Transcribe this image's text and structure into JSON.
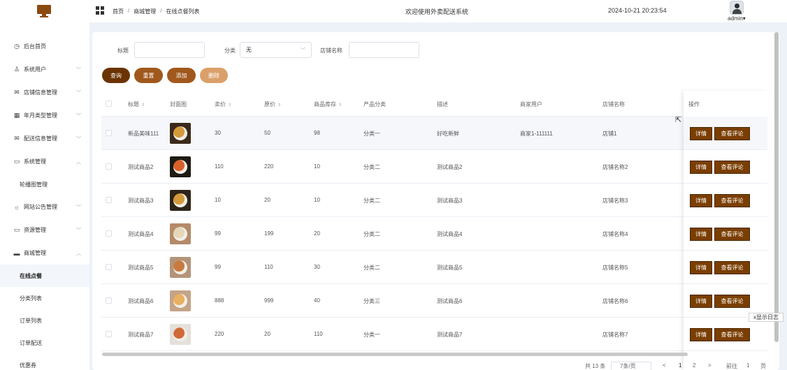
{
  "sidebar": {
    "items": [
      {
        "label": "后台首页",
        "icon": "clock-icon",
        "expand": ""
      },
      {
        "label": "系统用户",
        "icon": "user-icon",
        "expand": "chevron-down"
      },
      {
        "label": "店铺信息管理",
        "icon": "mail-icon",
        "expand": "chevron-down"
      },
      {
        "label": "年月类型管理",
        "icon": "calendar-icon",
        "expand": "chevron-down"
      },
      {
        "label": "配送信息管理",
        "icon": "mail-icon",
        "expand": "chevron-down"
      },
      {
        "label": "系统管理",
        "icon": "folder-icon",
        "expand": "chevron-up"
      }
    ],
    "system_sub": [
      {
        "label": "轮播图管理"
      }
    ],
    "items2": [
      {
        "label": "网站公告管理",
        "icon": "sun-icon",
        "expand": "chevron-down"
      },
      {
        "label": "资源管理",
        "icon": "monitor-icon",
        "expand": "chevron-down"
      },
      {
        "label": "商城管理",
        "icon": "shop-icon",
        "expand": "chevron-up"
      }
    ],
    "mall_sub": [
      {
        "label": "在线点餐",
        "active": true
      },
      {
        "label": "分类列表",
        "active": false
      },
      {
        "label": "订单列表",
        "active": false
      },
      {
        "label": "订单配送",
        "active": false
      },
      {
        "label": "优惠券",
        "active": false
      }
    ]
  },
  "header": {
    "breadcrumb": [
      "首页",
      "商城管理",
      "在线点餐列表"
    ],
    "breadcrumb_sep": "/",
    "welcome": "欢迎使用外卖配送系统",
    "datetime": "2024-10-21 20:23:54",
    "username": "admin",
    "username_caret": "▾"
  },
  "search": {
    "title_label": "标题",
    "title_value": "",
    "category_label": "分类",
    "category_value": "无",
    "store_label": "店铺名称",
    "store_value": ""
  },
  "buttons": {
    "query": "查询",
    "reset": "重置",
    "add": "添加",
    "delete": "删除"
  },
  "colors": {
    "query": "#6b3300",
    "reset": "#a0581c",
    "add": "#a0581c",
    "delete": "#dba06a",
    "op_button": "#7a3e00"
  },
  "table": {
    "headers": {
      "title": "标题",
      "cover": "封面图",
      "sale_price": "卖价",
      "orig_price": "原价",
      "stock": "商品库存",
      "category": "产品分类",
      "desc": "描述",
      "merchant": "商家用户",
      "store": "店铺名称",
      "ops": "操作"
    },
    "rows": [
      {
        "title": "新品美味111",
        "sale": "30",
        "orig": "50",
        "stock": "98",
        "cat": "分类一",
        "desc": "好吃新鲜",
        "merchant": "商家1-111111",
        "store": "店铺1",
        "plate": "#d49a3a",
        "bg": "#3a2a1a"
      },
      {
        "title": "测试商品2",
        "sale": "110",
        "orig": "220",
        "stock": "10",
        "cat": "分类二",
        "desc": "测试商品2",
        "merchant": "",
        "store": "店铺名称2",
        "plate": "#d8602a",
        "bg": "#1e1a14"
      },
      {
        "title": "测试商品3",
        "sale": "10",
        "orig": "20",
        "stock": "10",
        "cat": "分类二",
        "desc": "测试商品3",
        "merchant": "",
        "store": "店铺名称3",
        "plate": "#d49a3a",
        "bg": "#2e2418"
      },
      {
        "title": "测试商品4",
        "sale": "99",
        "orig": "199",
        "stock": "20",
        "cat": "分类二",
        "desc": "测试商品4",
        "merchant": "",
        "store": "店铺名称4",
        "plate": "#e6d7b8",
        "bg": "#b48a68"
      },
      {
        "title": "测试商品5",
        "sale": "99",
        "orig": "110",
        "stock": "30",
        "cat": "分类二",
        "desc": "测试商品5",
        "merchant": "",
        "store": "店铺名称5",
        "plate": "#c87a40",
        "bg": "#b49478"
      },
      {
        "title": "测试商品6",
        "sale": "888",
        "orig": "999",
        "stock": "40",
        "cat": "分类三",
        "desc": "测试商品6",
        "merchant": "",
        "store": "店铺名称6",
        "plate": "#e8b060",
        "bg": "#c4a488"
      },
      {
        "title": "测试商品7",
        "sale": "220",
        "orig": "20",
        "stock": "110",
        "cat": "分类一",
        "desc": "测试商品7",
        "merchant": "",
        "store": "店铺名称7",
        "plate": "#d06a38",
        "bg": "#e4e0da"
      }
    ],
    "op_detail": "详情",
    "op_reviews": "查看评论"
  },
  "log_button": "x显示日志",
  "pagination": {
    "total": "共 13 条",
    "page_size": "7条/页",
    "prev": "<",
    "pages": [
      "1",
      "2"
    ],
    "next": ">",
    "goto": "前往",
    "goto_page": "1",
    "page_unit": "页"
  }
}
